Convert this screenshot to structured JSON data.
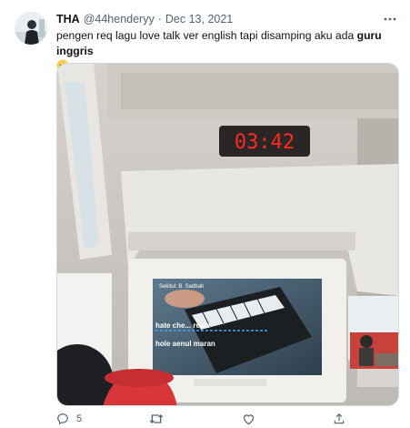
{
  "author": {
    "display_name": "THA",
    "handle": "@44henderyy",
    "separator": "·",
    "date": "Dec 13, 2021"
  },
  "tweet": {
    "text_part1": "pengen req lagu love talk ver english tapi disamping aku ada ",
    "text_bold": "guru inggris",
    "emoji": "pensive-smiling-face-emoji"
  },
  "media": {
    "clock_display": "03:42",
    "screen_song_title": "Sekitul: B. Sadbah",
    "lyric_line_1": "hate che... reste",
    "lyric_line_2": "hole   aenul  maran"
  },
  "actions": {
    "reply_count": "5",
    "retweet_count": "",
    "like_count": ""
  },
  "colors": {
    "text": "#0f1419",
    "muted": "#536471",
    "clock_red": "#ff2a1f"
  },
  "icons": [
    "more-icon",
    "reply-icon",
    "retweet-icon",
    "like-icon",
    "share-icon"
  ]
}
